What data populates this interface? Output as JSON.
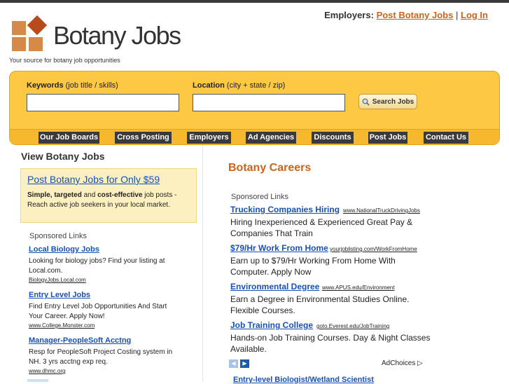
{
  "header": {
    "employers_label": "Employers:",
    "post_jobs_link": "Post Botany Jobs",
    "separator": "|",
    "login_link": "Log In",
    "logo_text": "Botany Jobs",
    "tagline": "Your source for botany job opportunities"
  },
  "search": {
    "keywords_label": "Keywords",
    "keywords_hint": "(job title / skills)",
    "keywords_value": "",
    "location_label": "Location",
    "location_hint": "(city + state / zip)",
    "location_value": "",
    "button_label": "Search Jobs"
  },
  "nav": [
    "Our Job Boards",
    "Cross Posting",
    "Employers",
    "Ad Agencies",
    "Discounts",
    "Post Jobs",
    "Contact Us"
  ],
  "sidebar": {
    "title": "View Botany Jobs",
    "promo_title": "Post Botany Jobs for Only $59",
    "promo_b1": "Simple, targeted",
    "promo_t1": " and ",
    "promo_b2": "cost-effective",
    "promo_t2": " job posts - Reach active job seekers in your local market.",
    "sponsored": "Sponsored Links",
    "ads": [
      {
        "title": "Local Biology Jobs",
        "desc": "Looking for biology jobs? Find your listing at Local.com.",
        "url": "BiologyJobs.Local.com"
      },
      {
        "title": "Entry Level Jobs",
        "desc": "Find Entry Level Job Opportunities And Start Your Career. Apply Now!",
        "url": "www.College.Monster.com"
      },
      {
        "title": "Manager-PeopleSoft Acctng",
        "desc": "Resp for PeopleSoft Project Costing system in NH. 3 yrs acctng exp req.",
        "url": "www.dhmc.org"
      }
    ]
  },
  "main": {
    "title": "Botany Careers",
    "sponsored": "Sponsored Links",
    "ads": [
      {
        "title": "Trucking Companies Hiring",
        "url": "www.NationalTruckDrivingJobs",
        "desc": "Hiring Inexperienced & Experienced Great Pay & Companies That Train"
      },
      {
        "title": "$79/Hr Work From Home",
        "url": "yourjoblisting.com/WorkFromHome",
        "desc": "Earn up to $79/Hr Working From Home With Computer. Apply Now"
      },
      {
        "title": "Environmental Degree",
        "url": "www.APUS.edu/Environment",
        "desc": "Earn a Degree in Environmental Studies Online. Flexible Courses."
      },
      {
        "title": "Job Training College",
        "url": "goto.Everest.edu/JobTraining",
        "desc": "Hands-on Job Training Courses. Day & Night Classes Available."
      }
    ],
    "adchoices": "AdChoices",
    "next_listing": "Entry-level Biologist/Wetland Scientist"
  },
  "colors": {
    "accent": "#c8641e",
    "link": "#1850b4",
    "search_bg": "#fdc844",
    "nav_item": "#3a3a3a"
  }
}
